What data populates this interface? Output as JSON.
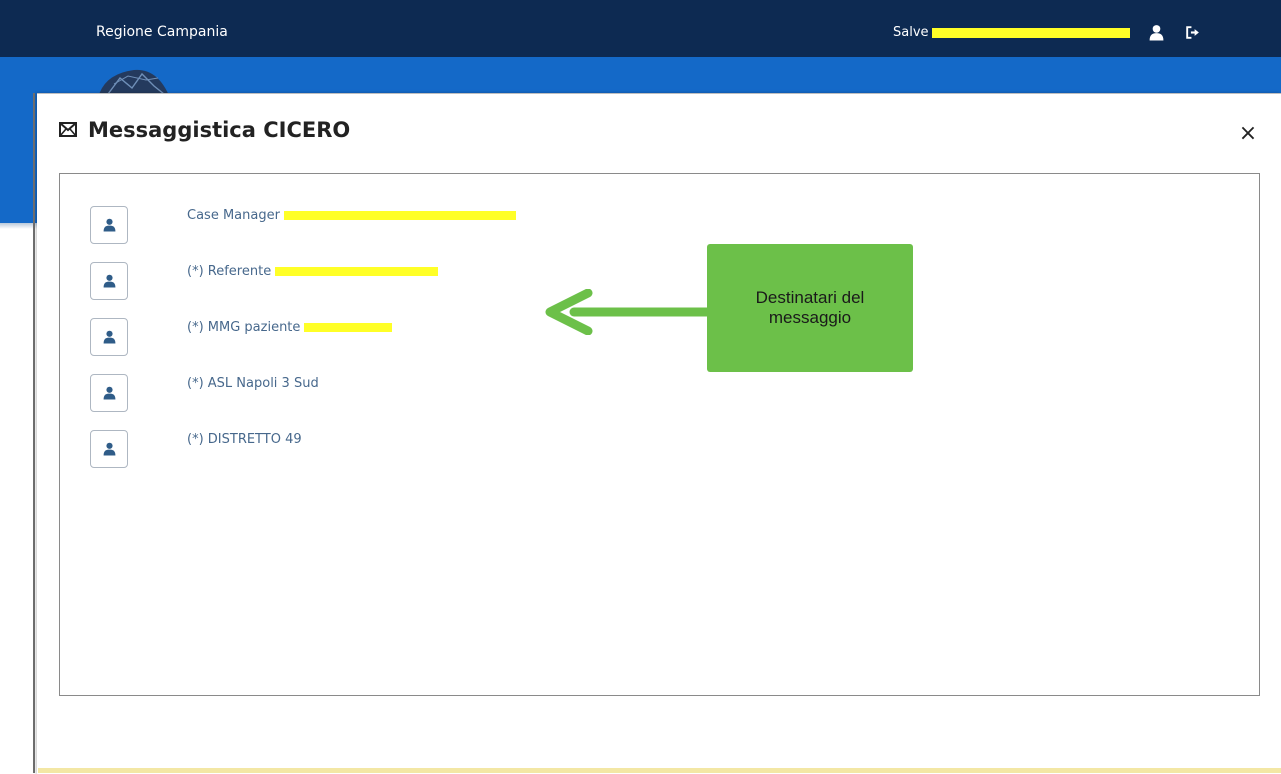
{
  "header": {
    "region": "Regione Campania",
    "greeting": "Salve"
  },
  "icons": {
    "user": "user-icon",
    "logout": "logout-icon",
    "mail": "envelope-icon",
    "close": "close-icon"
  },
  "modal": {
    "title": "Messaggistica CICERO",
    "close_label": "×"
  },
  "recipients": [
    {
      "label": "Case Manager"
    },
    {
      "label": "(*) Referente"
    },
    {
      "label": "(*) MMG paziente"
    },
    {
      "label": "(*) ASL Napoli 3 Sud"
    },
    {
      "label": "(*) DISTRETTO 49"
    }
  ],
  "annotation": {
    "text": "Destinatari del messaggio"
  },
  "colors": {
    "topbar": "#0d2a52",
    "bluebar": "#1469c8",
    "link": "#47688c",
    "redaction": "#ffff27",
    "callout": "#6cc049"
  }
}
